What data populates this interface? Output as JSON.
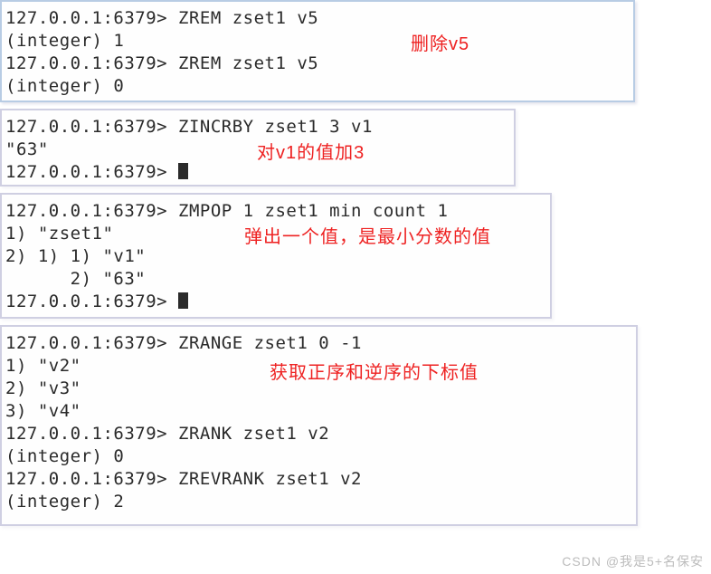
{
  "panel1": {
    "lines": [
      "127.0.0.1:6379> ZREM zset1 v5",
      "(integer) 1",
      "127.0.0.1:6379> ZREM zset1 v5",
      "(integer) 0"
    ],
    "annotation": "删除v5"
  },
  "panel2": {
    "lines": [
      "127.0.0.1:6379> ZINCRBY zset1 3 v1",
      "\"63\"",
      "127.0.0.1:6379> "
    ],
    "annotation": "对v1的值加3"
  },
  "panel3": {
    "lines": [
      "127.0.0.1:6379> ZMPOP 1 zset1 min count 1",
      "1) \"zset1\"",
      "2) 1) 1) \"v1\"",
      "      2) \"63\"",
      "127.0.0.1:6379> "
    ],
    "annotation": "弹出一个值，是最小分数的值"
  },
  "panel4": {
    "lines": [
      "127.0.0.1:6379> ZRANGE zset1 0 -1",
      "1) \"v2\"",
      "2) \"v3\"",
      "3) \"v4\"",
      "127.0.0.1:6379> ZRANK zset1 v2",
      "(integer) 0",
      "127.0.0.1:6379> ZREVRANK zset1 v2",
      "(integer) 2"
    ],
    "annotation": "获取正序和逆序的下标值"
  },
  "watermark": "CSDN @我是5+名保安"
}
